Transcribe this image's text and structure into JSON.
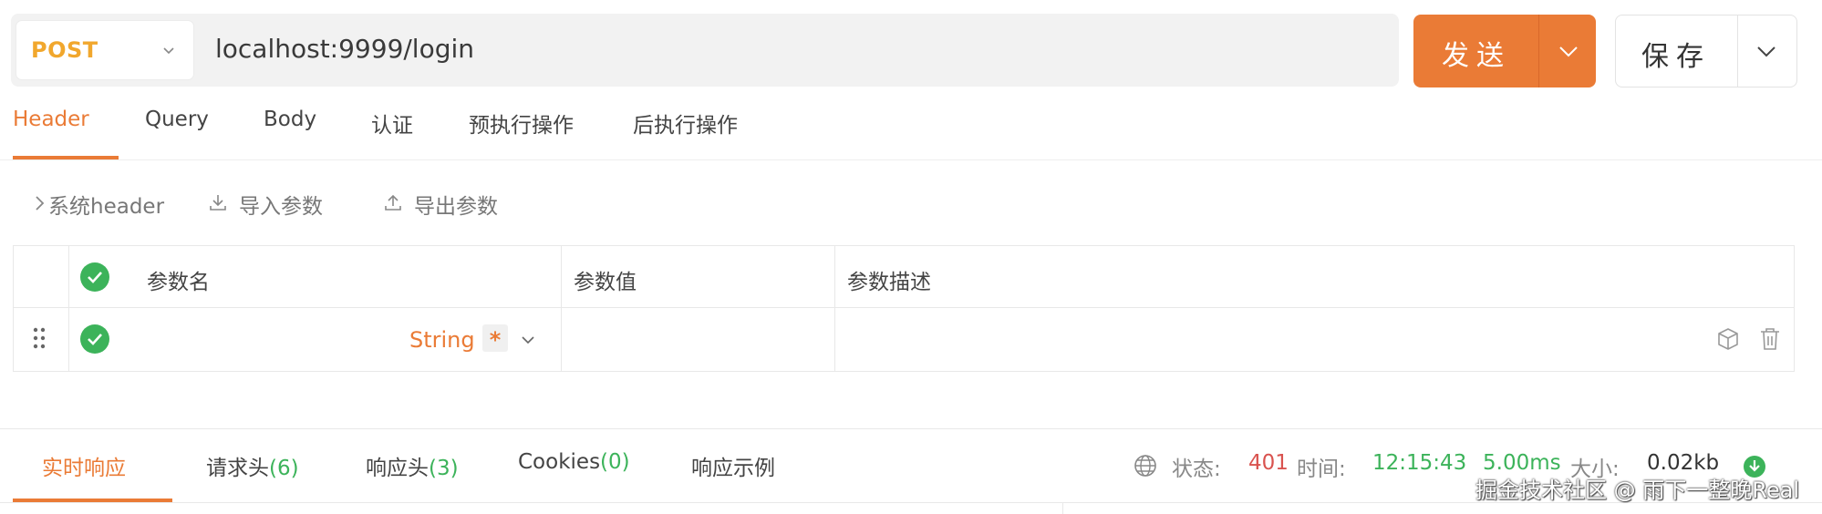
{
  "request": {
    "method": "POST",
    "url": "localhost:9999/login",
    "send_label": "发送",
    "save_label": "保存"
  },
  "tabs": [
    {
      "label": "Header",
      "active": true
    },
    {
      "label": "Query",
      "active": false
    },
    {
      "label": "Body",
      "active": false
    },
    {
      "label": "认证",
      "active": false
    },
    {
      "label": "预执行操作",
      "active": false
    },
    {
      "label": "后执行操作",
      "active": false
    }
  ],
  "toolbar": {
    "system_header": "系统header",
    "import_params": "导入参数",
    "export_params": "导出参数"
  },
  "table": {
    "headers": {
      "name": "参数名",
      "value": "参数值",
      "description": "参数描述"
    },
    "rows": [
      {
        "name": "",
        "type": "String",
        "required_mark": "*",
        "value": "",
        "description": ""
      }
    ]
  },
  "response": {
    "tabs": [
      {
        "label": "实时响应",
        "count": "",
        "active": true
      },
      {
        "label": "请求头",
        "count": "(6)",
        "active": false
      },
      {
        "label": "响应头",
        "count": "(3)",
        "active": false
      },
      {
        "label": "Cookies",
        "count": "(0)",
        "active": false
      },
      {
        "label": "响应示例",
        "count": "",
        "active": false
      }
    ],
    "status_label": "状态:",
    "status_value": "401",
    "time_label": "时间:",
    "time_value": "12:15:43",
    "duration_value": "5.00ms",
    "size_label": "大小:",
    "size_value": "0.02kb"
  },
  "watermark": "掘金技术社区 @ 雨下一整晚Real",
  "colors": {
    "accent": "#ea7b36",
    "method": "#f1a72d",
    "success": "#3cb35a",
    "error": "#d9534f"
  },
  "icons": [
    "chevron-down-icon",
    "chevron-right-icon",
    "download-icon",
    "upload-icon",
    "drag-handle-icon",
    "check-circle-icon",
    "cube-icon",
    "trash-icon",
    "globe-icon",
    "download-circle-icon"
  ]
}
